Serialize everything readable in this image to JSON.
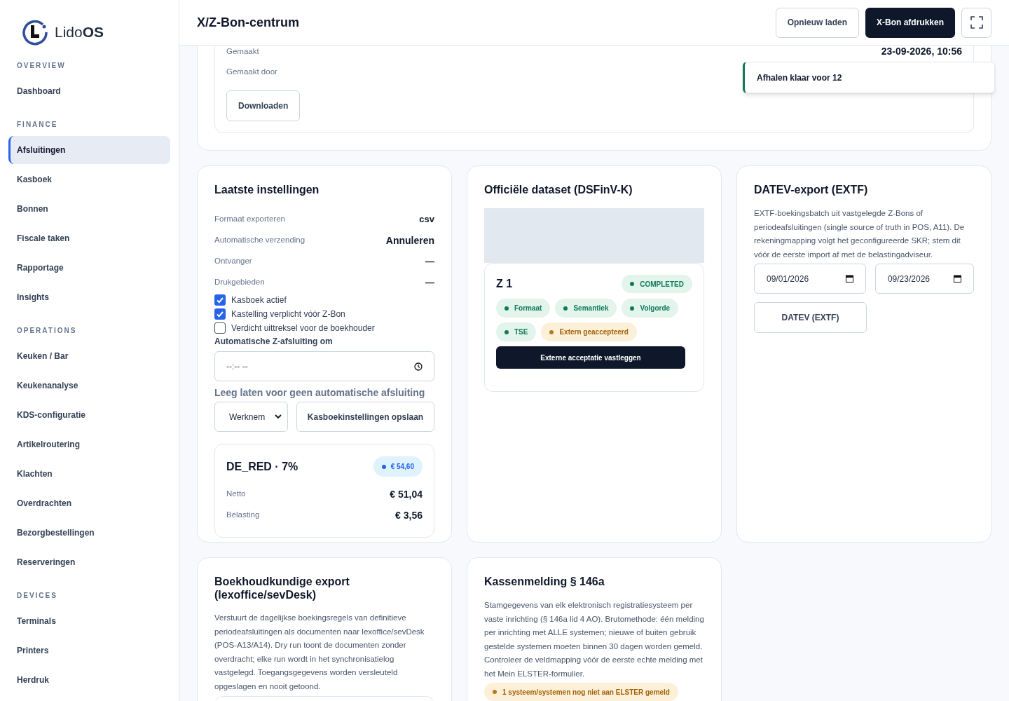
{
  "sidebar": {
    "logo": "Lido**OS**",
    "sections": [
      {
        "heading": "OVERVIEW",
        "items": [
          {
            "label": "Dashboard",
            "selected": false
          }
        ]
      },
      {
        "heading": "FINANCE",
        "items": [
          {
            "label": "Afsluitingen",
            "selected": true
          },
          {
            "label": "Kasboek",
            "selected": false
          },
          {
            "label": "Bonnen",
            "selected": false
          },
          {
            "label": "Fiscale taken",
            "selected": false
          },
          {
            "label": "Rapportage",
            "selected": false
          },
          {
            "label": "Insights",
            "selected": false
          }
        ]
      },
      {
        "heading": "OPERATIONS",
        "items": [
          {
            "label": "Keuken / Bar",
            "selected": false
          },
          {
            "label": "Keukenanalyse",
            "selected": false
          },
          {
            "label": "KDS-configuratie",
            "selected": false
          },
          {
            "label": "Artikelroutering",
            "selected": false
          },
          {
            "label": "Klachten",
            "selected": false
          },
          {
            "label": "Overdrachten",
            "selected": false
          },
          {
            "label": "Bezorgbestellingen",
            "selected": false
          },
          {
            "label": "Reserveringen",
            "selected": false
          }
        ]
      },
      {
        "heading": "DEVICES",
        "items": [
          {
            "label": "Terminals",
            "selected": false
          },
          {
            "label": "Printers",
            "selected": false
          },
          {
            "label": "Herdruk",
            "selected": false
          }
        ]
      }
    ]
  },
  "header": {
    "title": "X/Z-Bon-centrum",
    "buttons": [
      {
        "label": "Opnieuw laden",
        "kind": "outline"
      },
      {
        "label": "X-Bon afdrukken",
        "kind": "primary"
      }
    ]
  },
  "toast": {
    "text": "Afhalen klaar voor 12"
  },
  "summary_card": {
    "rows": [
      {
        "label": "Gemaakt",
        "value": "23-09-2026, 10:56"
      },
      {
        "label": "Gemaakt door"
      }
    ],
    "button": "Downloaden"
  },
  "settings_card": {
    "title": "Laatste instellingen",
    "rows": [
      {
        "label": "Formaat exporteren",
        "value": "csv"
      },
      {
        "label": "Automatische verzending",
        "value": "Annuleren"
      },
      {
        "label": "Ontvanger",
        "value": "—"
      },
      {
        "label": "Drukgebieden",
        "value": "—"
      }
    ],
    "checkboxes": [
      {
        "label": "Kasboek actief",
        "checked": true
      },
      {
        "label": "Kastelling verplicht vóór Z-Bon",
        "checked": true
      },
      {
        "label": "Verdicht uittreksel voor de boekhouder",
        "checked": false
      }
    ],
    "time_label": "Automatische Z-afsluiting om",
    "time_value": "--:-- --",
    "hint": "Leeg laten voor geen automatische afsluiting",
    "select_value": "Werknem",
    "save_button": "Kasboekinstellingen opslaan",
    "tax": {
      "title": "DE_RED · 7%",
      "badge": {
        "label": "€ 54,60",
        "color": "#2563eb"
      },
      "rows": [
        {
          "label": "Netto",
          "value": "€ 51,04"
        },
        {
          "label": "Belasting",
          "value": "€ 3,56"
        }
      ]
    }
  },
  "dataset_card": {
    "title": "Officiële dataset (DSFinV-K)",
    "entry": {
      "name": "Z 1",
      "status": {
        "label": "COMPLETED",
        "kind": "success",
        "color": "#0f7a5a"
      },
      "tags": [
        {
          "label": "Formaat",
          "kind": "success",
          "color": "#0f7a5a"
        },
        {
          "label": "Semantiek",
          "kind": "success",
          "color": "#0f7a5a"
        },
        {
          "label": "Volgorde",
          "kind": "success",
          "color": "#0f7a5a"
        },
        {
          "label": "TSE",
          "kind": "success",
          "color": "#0f7a5a"
        },
        {
          "label": "Extern geaccepteerd",
          "kind": "warning",
          "color": "#b7791f"
        }
      ],
      "button": "Externe acceptatie vastleggen"
    }
  },
  "datev_card": {
    "title": "DATEV-export (EXTF)",
    "description": "EXTF-boekingsbatch uit vastgelegde Z-Bons of periodeafsluitingen (single source of truth in POS, A11). De rekeningmapping volgt het geconfigureerde SKR; stem dit vóór de eerste import af met de belastingadviseur.",
    "date_from": "09/01/2026",
    "date_to": "09/23/2026",
    "button": "DATEV (EXTF)"
  },
  "accounting_card": {
    "title": "Boekhoudkundige export (lexoffice/sevDesk)",
    "description": "Verstuurt de dagelijkse boekingsregels van definitieve periodeafsluitingen als documenten naar lexoffice/sevDesk (POS-A13/A14). Dry run toont de documenten zonder overdracht; elke run wordt in het synchronisatielog vastgelegd. Toegangsgegevens worden versleuteld opgeslagen en nooit getoond."
  },
  "register_card": {
    "title": "Kassenmelding § 146a",
    "description": "Stamgegevens van elk elektronisch registratiesysteem per vaste inrichting (§ 146a lid 4 AO). Brutomethode: één melding per inrichting met ALLE systemen; nieuwe of buiten gebruik gestelde systemen moeten binnen 30 dagen worden gemeld. Controleer de veldmapping vóór de eerste echte melding met het Mein ELSTER-formulier.",
    "warning": {
      "label": "1 systeem/systemen nog niet aan ELSTER gemeld",
      "kind": "warning",
      "color": "#b7791f"
    }
  }
}
